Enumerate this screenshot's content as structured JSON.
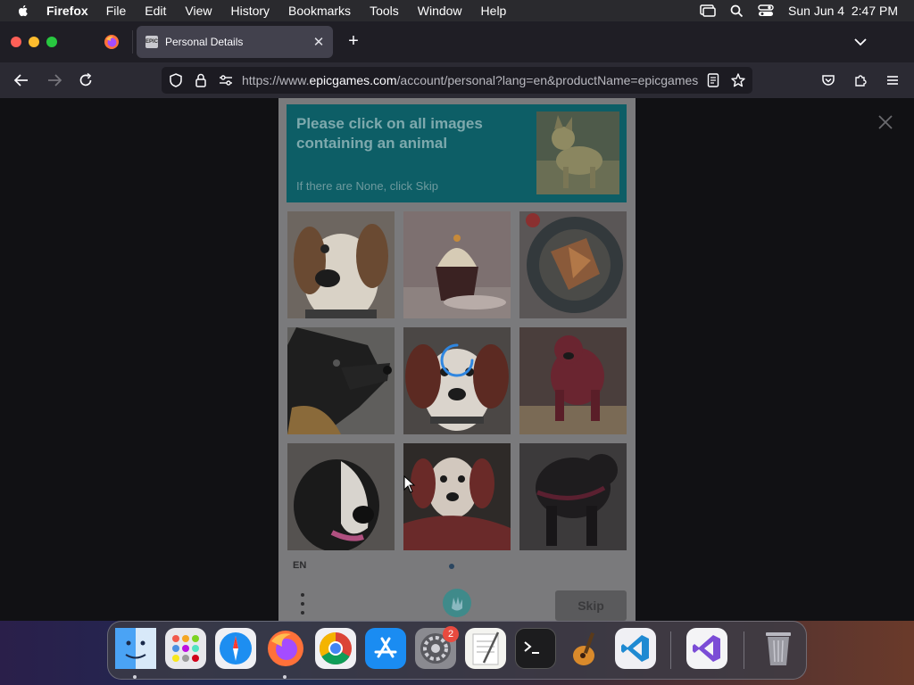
{
  "menubar": {
    "app_name": "Firefox",
    "items": [
      "File",
      "Edit",
      "View",
      "History",
      "Bookmarks",
      "Tools",
      "Window",
      "Help"
    ],
    "clock": "Sun Jun 4  2:47 PM"
  },
  "browser": {
    "tab_title": "Personal Details",
    "tab_favicon_text": "EPIC",
    "new_tab": "+",
    "url_prefix": "https://www.",
    "url_domain": "epicgames.com",
    "url_rest": "/account/personal?lang=en&productName=epicgames"
  },
  "captcha": {
    "prompt": "Please click on all images containing an animal",
    "hint": "If there are None, click Skip",
    "language": "EN",
    "skip_label": "Skip"
  },
  "dock": {
    "badge_count": "2",
    "apps": [
      "finder",
      "launchpad",
      "safari",
      "firefox",
      "chrome",
      "app-store",
      "system-settings",
      "textedit",
      "terminal",
      "garageband",
      "vscode",
      "visual-studio",
      "trash"
    ]
  },
  "colors": {
    "captcha_header": "#0d5e66",
    "captcha_overlay": "#7a7a7c",
    "spinner": "#2f86e0"
  }
}
